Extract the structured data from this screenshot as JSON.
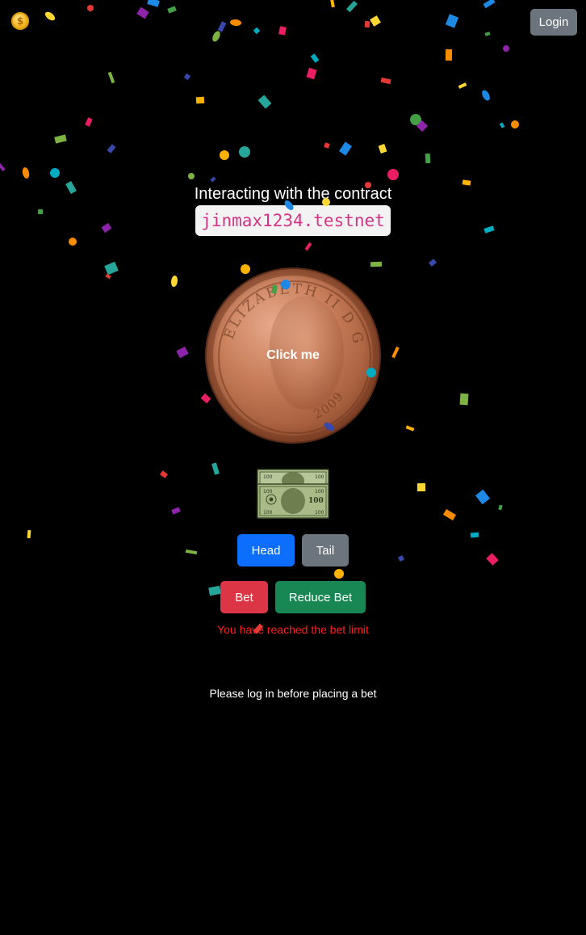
{
  "nav": {
    "logo_icon": "coin-logo-icon",
    "logo_glyph": "$",
    "login_label": "Login"
  },
  "contract": {
    "title": "Interacting with the contract",
    "name": "jinmax1234.testnet"
  },
  "coin": {
    "label": "Click me",
    "icon": "coin-icon"
  },
  "money": {
    "icon": "money-icon"
  },
  "choice": {
    "head_label": "Head",
    "tail_label": "Tail"
  },
  "bet": {
    "bet_label": "Bet",
    "reduce_label": "Reduce Bet",
    "limit_message": "You have reached the bet limit"
  },
  "status": {
    "login_message": "Please log in before placing a bet"
  },
  "colors": {
    "background": "#000000",
    "primary": "#0d6efd",
    "secondary": "#6c757d",
    "danger": "#dc3545",
    "success": "#198754",
    "error_text": "#ff1e1e",
    "code_text": "#d63384"
  }
}
